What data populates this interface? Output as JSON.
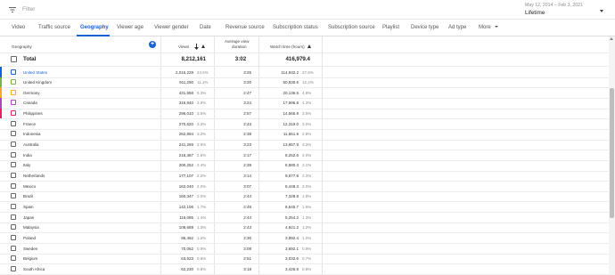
{
  "filter": {
    "placeholder": "Filter",
    "icon": "filter-icon"
  },
  "date": {
    "range": "May 12, 2014 – Feb 3, 2021",
    "label": "Lifetime"
  },
  "tabs": [
    {
      "label": "Video"
    },
    {
      "label": "Traffic source"
    },
    {
      "label": "Geography"
    },
    {
      "label": "Viewer age"
    },
    {
      "label": "Viewer gender"
    },
    {
      "label": "Date"
    },
    {
      "label": "Revenue source"
    },
    {
      "label": "Subscription status"
    },
    {
      "label": "Subscription source"
    },
    {
      "label": "Playlist"
    },
    {
      "label": "Device type"
    },
    {
      "label": "Ad type"
    },
    {
      "label": "More"
    }
  ],
  "active_tab": "Geography",
  "colors": {
    "accent": "#1a5fd6"
  },
  "columns": {
    "geo": "Geography",
    "views": "Views",
    "avd_line1": "Average view",
    "avd_line2": "duration",
    "watch": "Watch time (hours)"
  },
  "total": {
    "label": "Total",
    "views": "8,212,161",
    "avd": "3:02",
    "watch": "416,979.4"
  },
  "rows": [
    {
      "name": "United States",
      "views": "2,015,229",
      "vp": "24.5%",
      "avd": "3:25",
      "watch": "114,932.2",
      "wp": "27.6%",
      "color": "#1a5fd6"
    },
    {
      "name": "United Kingdom",
      "views": "911,290",
      "vp": "11.1%",
      "avd": "3:20",
      "watch": "50,830.5",
      "wp": "12.2%",
      "color": "#7cb342"
    },
    {
      "name": "Germany",
      "views": "431,558",
      "vp": "5.3%",
      "avd": "2:47",
      "watch": "20,136.5",
      "wp": "4.8%",
      "color": "#f9a825"
    },
    {
      "name": "Canada",
      "views": "316,940",
      "vp": "3.9%",
      "avd": "3:24",
      "watch": "17,996.8",
      "wp": "4.3%",
      "color": "#ab47bc"
    },
    {
      "name": "Philippines",
      "views": "296,010",
      "vp": "3.6%",
      "avd": "2:57",
      "watch": "14,565.9",
      "wp": "3.5%",
      "color": "#e91e63"
    },
    {
      "name": "France",
      "views": "270,620",
      "vp": "3.3%",
      "avd": "2:43",
      "watch": "12,319.0",
      "wp": "3.0%",
      "color": ""
    },
    {
      "name": "Indonesia",
      "views": "262,894",
      "vp": "3.2%",
      "avd": "2:38",
      "watch": "11,561.9",
      "wp": "2.8%",
      "color": ""
    },
    {
      "name": "Australia",
      "views": "241,269",
      "vp": "2.9%",
      "avd": "3:23",
      "watch": "13,657.9",
      "wp": "3.3%",
      "color": ""
    },
    {
      "name": "India",
      "views": "216,367",
      "vp": "2.6%",
      "avd": "2:17",
      "watch": "8,252.6",
      "wp": "2.0%",
      "color": ""
    },
    {
      "name": "Italy",
      "views": "200,252",
      "vp": "2.4%",
      "avd": "2:39",
      "watch": "8,880.3",
      "wp": "2.1%",
      "color": ""
    },
    {
      "name": "Netherlands",
      "views": "177,107",
      "vp": "2.2%",
      "avd": "3:14",
      "watch": "9,577.8",
      "wp": "2.3%",
      "color": ""
    },
    {
      "name": "Mexico",
      "views": "162,040",
      "vp": "2.0%",
      "avd": "3:07",
      "watch": "8,448.3",
      "wp": "2.0%",
      "color": ""
    },
    {
      "name": "Brazil",
      "views": "160,347",
      "vp": "2.0%",
      "avd": "2:44",
      "watch": "7,328.8",
      "wp": "1.8%",
      "color": ""
    },
    {
      "name": "Spain",
      "views": "142,106",
      "vp": "1.7%",
      "avd": "2:48",
      "watch": "6,645.7",
      "wp": "1.6%",
      "color": ""
    },
    {
      "name": "Japan",
      "views": "115,085",
      "vp": "1.4%",
      "avd": "2:44",
      "watch": "5,254.2",
      "wp": "1.3%",
      "color": ""
    },
    {
      "name": "Malaysia",
      "views": "108,689",
      "vp": "1.3%",
      "avd": "2:43",
      "watch": "4,921.2",
      "wp": "1.2%",
      "color": ""
    },
    {
      "name": "Poland",
      "views": "95,462",
      "vp": "1.2%",
      "avd": "2:30",
      "watch": "3,992.4",
      "wp": "1.0%",
      "color": ""
    },
    {
      "name": "Sweden",
      "views": "70,062",
      "vp": "0.9%",
      "avd": "3:09",
      "watch": "3,692.1",
      "wp": "0.9%",
      "color": ""
    },
    {
      "name": "Belgium",
      "views": "63,523",
      "vp": "0.8%",
      "avd": "2:51",
      "watch": "3,032.6",
      "wp": "0.7%",
      "color": ""
    },
    {
      "name": "South Africa",
      "views": "62,230",
      "vp": "0.8%",
      "avd": "3:18",
      "watch": "3,426.5",
      "wp": "0.8%",
      "color": ""
    }
  ]
}
